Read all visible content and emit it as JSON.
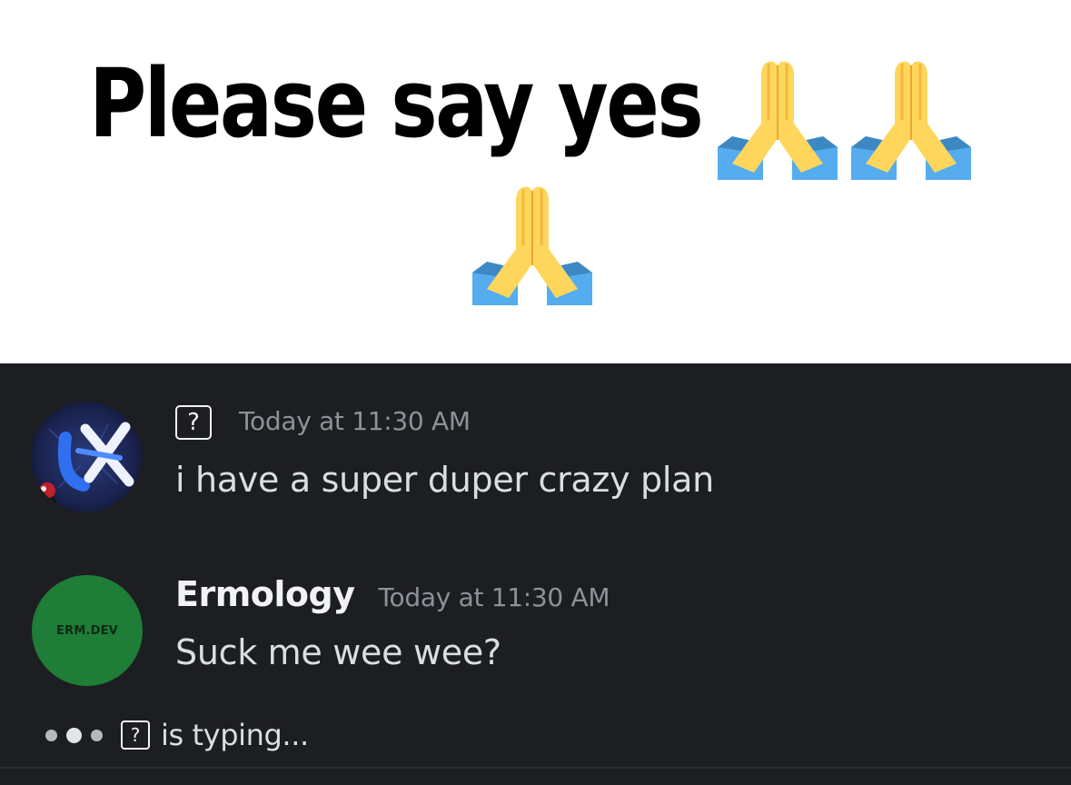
{
  "caption": {
    "text": "Please say yes",
    "emoji": [
      "folded-hands",
      "folded-hands",
      "folded-hands"
    ]
  },
  "messages": [
    {
      "author": "",
      "author_unknown_glyph": "?",
      "timestamp": "Today at 11:30 AM",
      "text": "i have a super duper crazy plan",
      "avatar": "blue-x-logo-avatar"
    },
    {
      "author": "Ermology",
      "timestamp": "Today at 11:30 AM",
      "text": "Suck me wee wee?",
      "avatar_text": "ERM.DEV",
      "avatar_color": "#1e7d36"
    }
  ],
  "typing_indicator": {
    "user_glyph": "?",
    "text": "is typing..."
  },
  "colors": {
    "chat_background": "#1d1e22",
    "username": "#f2f3f5",
    "timestamp": "#8e9199",
    "message_text": "#dbdee1",
    "emoji_hand": "#ffd65c",
    "emoji_sleeve": "#55acee"
  }
}
